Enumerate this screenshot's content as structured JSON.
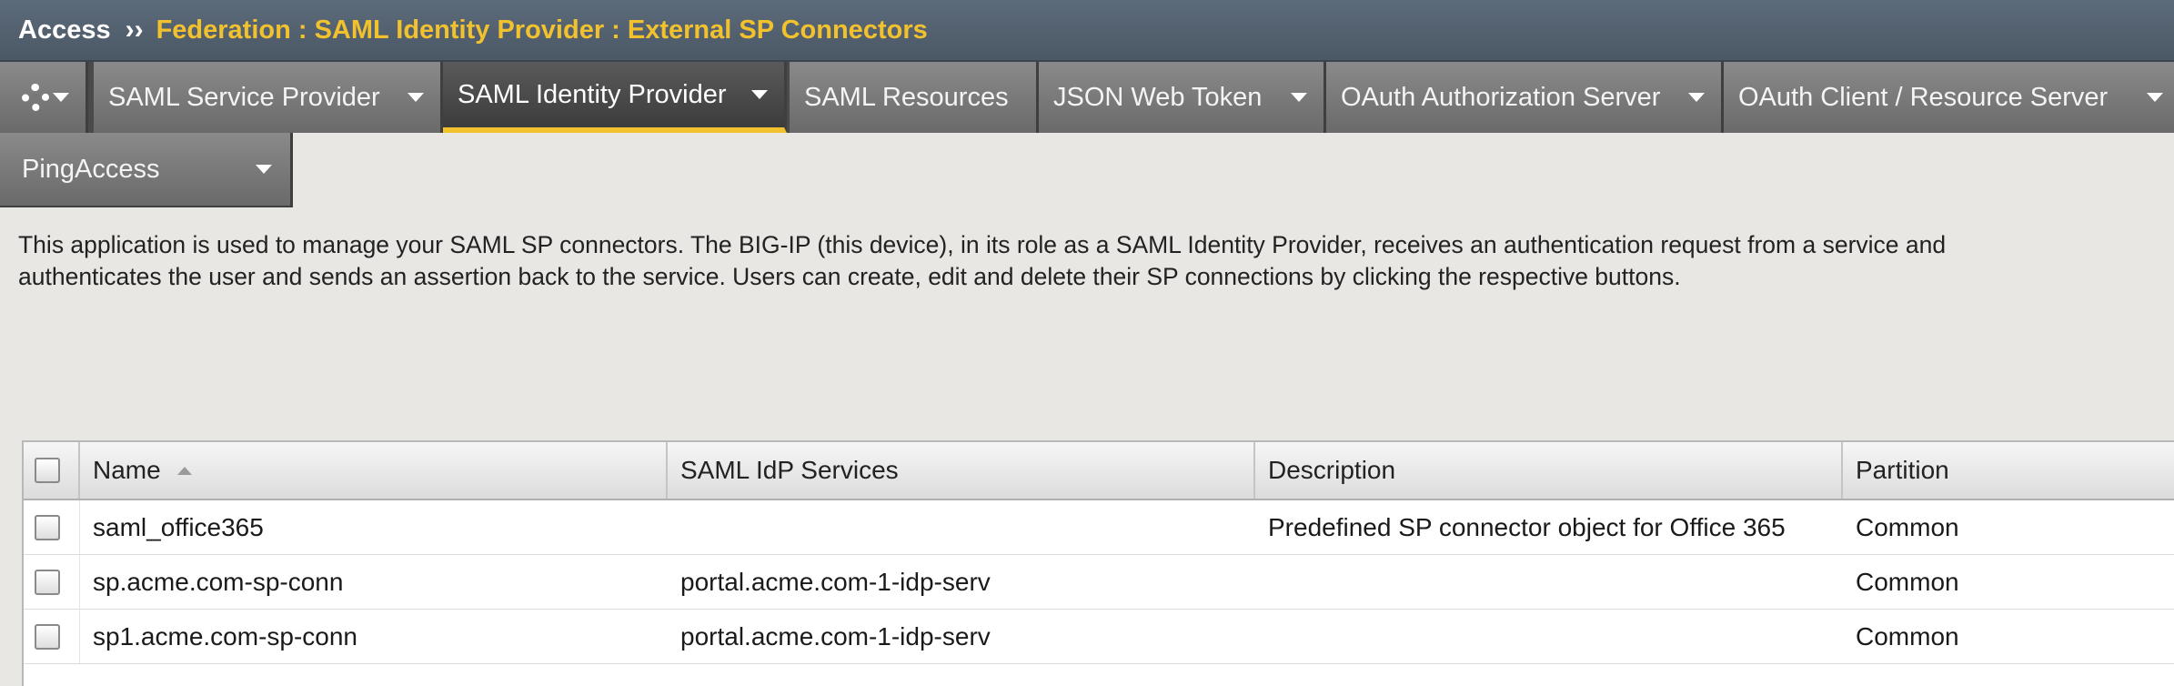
{
  "breadcrumb": {
    "root": "Access",
    "separator": "››",
    "path": "Federation : SAML Identity Provider : External SP Connectors"
  },
  "tabs": [
    {
      "label": "SAML Service Provider",
      "active": false
    },
    {
      "label": "SAML Identity Provider",
      "active": true
    },
    {
      "label": "SAML Resources",
      "active": false
    },
    {
      "label": "JSON Web Token",
      "active": false
    },
    {
      "label": "OAuth Authorization Server",
      "active": false
    },
    {
      "label": "OAuth Client / Resource Server",
      "active": false
    }
  ],
  "tab_row2": {
    "label": "PingAccess"
  },
  "description": {
    "line1": "This application is used to manage your SAML SP connectors. The BIG-IP (this device), in its role as a SAML Identity Provider, receives an authentication request from a service and",
    "line2": "authenticates the user and sends an assertion back to the service. Users can create, edit and delete their SP connections by clicking the respective buttons."
  },
  "table": {
    "columns": [
      "Name",
      "SAML IdP Services",
      "Description",
      "Partition"
    ],
    "sort_column": "Name",
    "rows": [
      {
        "name": "saml_office365",
        "services": "",
        "description": "Predefined SP connector object for Office 365",
        "partition": "Common"
      },
      {
        "name": "sp.acme.com-sp-conn",
        "services": "portal.acme.com-1-idp-serv",
        "description": "",
        "partition": "Common"
      },
      {
        "name": "sp1.acme.com-sp-conn",
        "services": "portal.acme.com-1-idp-serv",
        "description": "",
        "partition": "Common"
      }
    ]
  },
  "colors": {
    "accent": "#f2c12e",
    "titlebar": "#4b5866",
    "tab": "#777777"
  }
}
